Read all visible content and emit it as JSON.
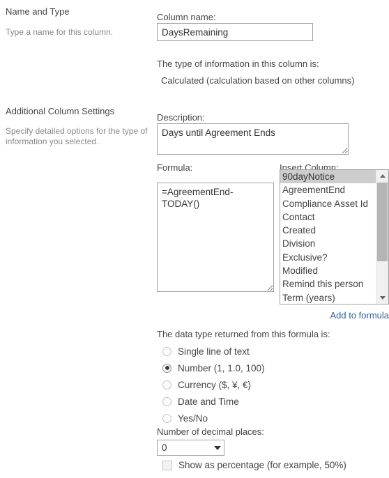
{
  "sections": [
    {
      "title": "Name and Type",
      "description": "Type a name for this column."
    },
    {
      "title": "Additional Column Settings",
      "description": "Specify detailed options for the type of information you selected."
    }
  ],
  "form": {
    "column_name_label": "Column name:",
    "column_name_value": "DaysRemaining",
    "type_info_label": "The type of information in this column is:",
    "type_info_value": "Calculated (calculation based on other columns)",
    "description_label": "Description:",
    "description_value": "Days until Agreement Ends",
    "formula_label": "Formula:",
    "formula_value": "=AgreementEnd-TODAY()",
    "insert_column_label": "Insert Column:",
    "insert_column_items": [
      "90dayNotice",
      "AgreementEnd",
      "Compliance Asset Id",
      "Contact",
      "Created",
      "Division",
      "Exclusive?",
      "Modified",
      "Remind this person",
      "Term (years)"
    ],
    "insert_column_selected": "90dayNotice",
    "add_to_formula_label": "Add to formula",
    "datatype_label": "The data type returned from this formula is:",
    "datatype_options": [
      {
        "label": "Single line of text",
        "checked": false
      },
      {
        "label": "Number (1, 1.0, 100)",
        "checked": true
      },
      {
        "label": "Currency ($, ¥, €)",
        "checked": false
      },
      {
        "label": "Date and Time",
        "checked": false
      },
      {
        "label": "Yes/No",
        "checked": false
      }
    ],
    "decimals_label": "Number of decimal places:",
    "decimals_value": "0",
    "percentage_label": "Show as percentage (for example, 50%)",
    "percentage_checked": false
  },
  "icons": {
    "scroll_up": "scroll-up-arrow-icon",
    "scroll_down": "scroll-down-arrow-icon",
    "dropdown": "chevron-down-icon",
    "resize_grip": "resize-grip-icon"
  },
  "colors": {
    "link": "#2f5f9e",
    "selected_row": "#cdcdcd",
    "border": "#a0a0a0"
  }
}
